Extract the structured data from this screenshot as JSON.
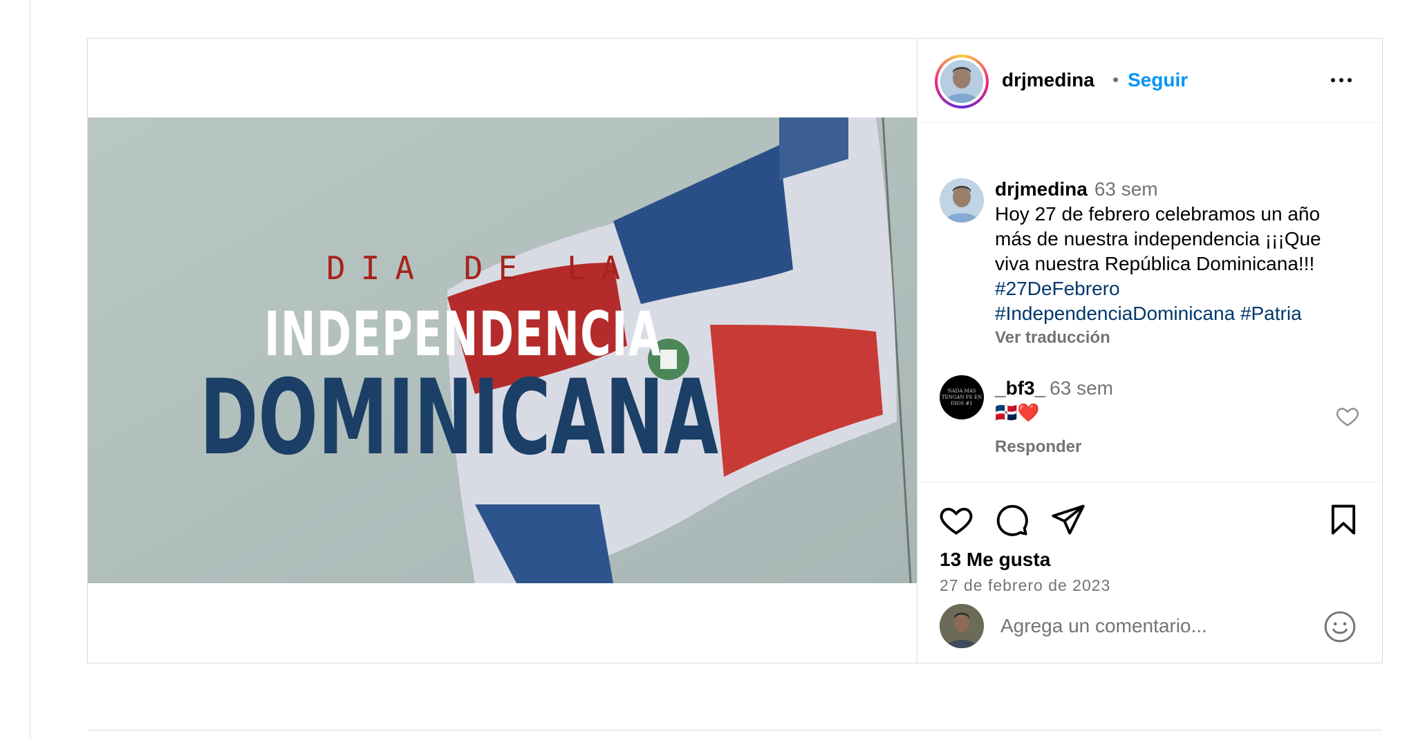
{
  "post": {
    "image_text": {
      "line1": "DIA DE LA",
      "line2": "INDEPENDENCIA",
      "line3": "DOMINICANA"
    },
    "header": {
      "username": "drjmedina",
      "separator": "•",
      "follow_label": "Seguir",
      "more_icon": "more-horizontal-icon"
    },
    "caption": {
      "username": "drjmedina",
      "time": "63 sem",
      "text": "Hoy 27 de febrero celebramos un año más de nuestra independencia ¡¡¡Que viva nuestra República Dominicana!!!",
      "hashtags": [
        "#27DeFebrero",
        "#IndependenciaDominicana",
        "#Patria"
      ],
      "translate_label": "Ver traducción"
    },
    "comments": [
      {
        "username": "_bf3_",
        "time": "63 sem",
        "text": "🇩🇴❤️",
        "avatar_text": "NADA MAS TENGAN FE EN DIOS #1",
        "reply_label": "Responder"
      }
    ],
    "actions": {
      "icons": [
        "heart-icon",
        "comment-icon",
        "share-icon",
        "bookmark-icon"
      ],
      "likes": "13 Me gusta",
      "date": "27 de febrero de 2023"
    },
    "add_comment": {
      "placeholder": "Agrega un comentario..."
    }
  },
  "colors": {
    "link_blue": "#0095f6",
    "hashtag": "#00376b",
    "muted": "#737373",
    "border": "#dbdbdb",
    "title_red": "#a6231d",
    "title_navy": "#1b3f66"
  }
}
